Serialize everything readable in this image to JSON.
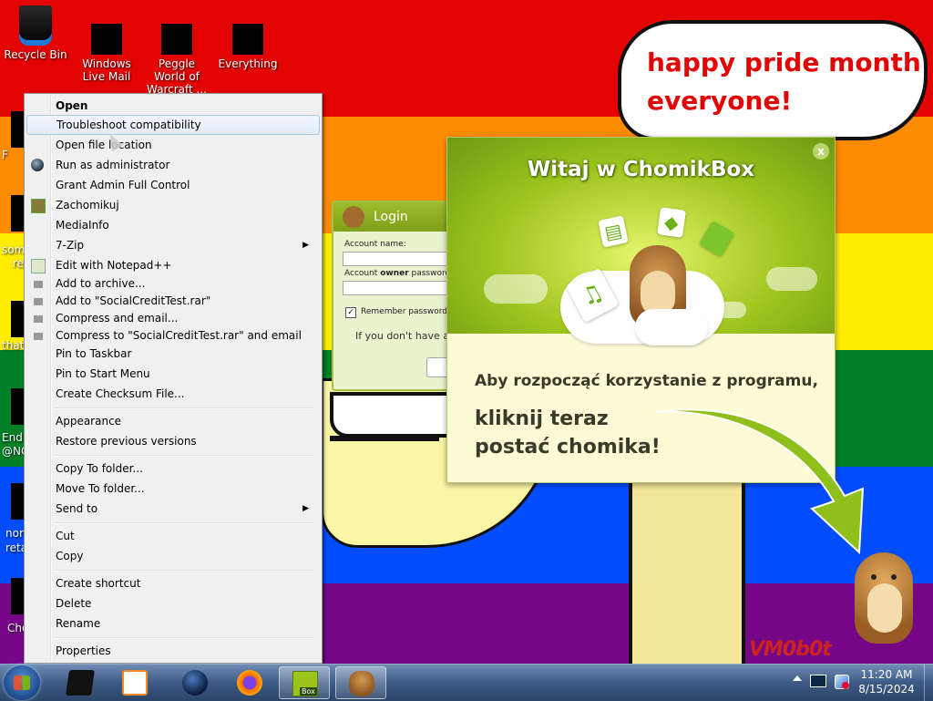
{
  "desktop": {
    "icons": [
      {
        "label": "Recycle Bin",
        "icon": "recycle-bin-icon"
      },
      {
        "label": "Windows Live Mail",
        "icon": "windows-live-mail-icon"
      },
      {
        "label": "Peggle World of Warcraft ...",
        "icon": "peggle-icon"
      },
      {
        "label": "Everything",
        "icon": "everything-icon"
      }
    ],
    "partial_icon_text": [
      "F",
      "som",
      "re",
      "that",
      "e",
      "End",
      "@NC",
      "nor",
      "reta",
      "Cho"
    ],
    "speech_bubble": [
      "happy pride month",
      "everyone!"
    ],
    "watermark": "VM0b0t"
  },
  "login_window": {
    "title": "Login",
    "account_name_label": "Account name:",
    "password_label_prefix": "Account ",
    "password_label_bold": "owner",
    "password_label_suffix": " password",
    "remember_label": "Remember password",
    "hint": "If you don't have an"
  },
  "chomikbox": {
    "title": "Witaj w ChomikBox",
    "close": "x",
    "line1": "Aby rozpocząć korzystanie z programu,",
    "line2a": "kliknij teraz",
    "line2b": "postać chomika!",
    "accent_color": "#9dc41d"
  },
  "context_menu": {
    "items": [
      {
        "label": "Open",
        "bold": true
      },
      {
        "label": "Troubleshoot compatibility",
        "hover": true
      },
      {
        "label": "Open file location"
      },
      {
        "label": "Run as administrator",
        "icon": "shield-icon"
      },
      {
        "label": "Grant Admin Full Control"
      },
      {
        "label": "Zachomikuj",
        "icon": "chomik-icon"
      },
      {
        "label": "MediaInfo"
      },
      {
        "label": "7-Zip",
        "submenu": true
      },
      {
        "label": "Edit with Notepad++",
        "icon": "notepad-plus-plus-icon"
      },
      {
        "label": "Add to archive...",
        "icon": "winrar-icon"
      },
      {
        "label": "Add to \"SocialCreditTest.rar\"",
        "icon": "winrar-icon"
      },
      {
        "label": "Compress and email...",
        "icon": "winrar-icon"
      },
      {
        "label": "Compress to \"SocialCreditTest.rar\" and email",
        "icon": "winrar-icon"
      },
      {
        "label": "Pin to Taskbar"
      },
      {
        "label": "Pin to Start Menu"
      },
      {
        "label": "Create Checksum File..."
      },
      {
        "label": "Appearance"
      },
      {
        "label": "Restore previous versions"
      },
      {
        "label": "Copy To folder..."
      },
      {
        "label": "Move To folder..."
      },
      {
        "label": "Send to",
        "submenu": true
      },
      {
        "label": "Cut"
      },
      {
        "label": "Copy"
      },
      {
        "label": "Create shortcut"
      },
      {
        "label": "Delete"
      },
      {
        "label": "Rename"
      },
      {
        "label": "Properties"
      }
    ],
    "submenu_arrow": "▶"
  },
  "taskbar": {
    "apps": [
      {
        "name": "command-prompt-icon"
      },
      {
        "name": "media-player-icon"
      },
      {
        "name": "globe-browser-icon"
      },
      {
        "name": "firefox-icon"
      },
      {
        "name": "chomikbox-icon",
        "active": true,
        "badge": "Box"
      },
      {
        "name": "chomik-hamster-icon",
        "active": true
      }
    ],
    "tray_icons": [
      "monitor-icon",
      "network-icon"
    ],
    "clock_time": "11:20 AM",
    "clock_date": "8/15/2024"
  }
}
